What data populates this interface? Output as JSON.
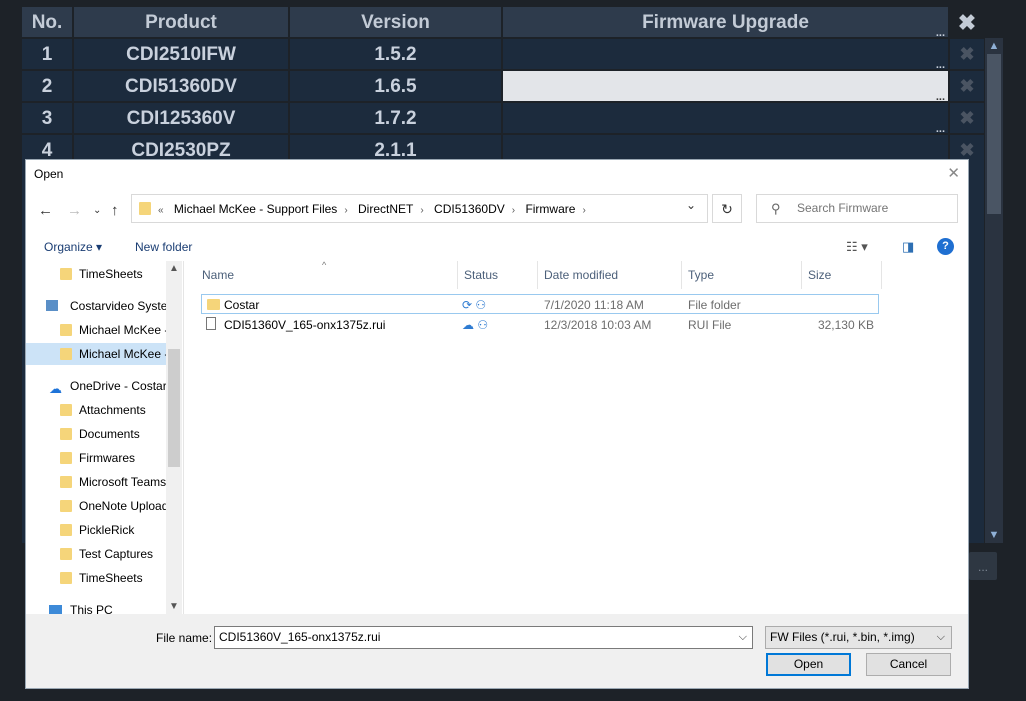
{
  "table": {
    "headers": {
      "no": "No.",
      "product": "Product",
      "version": "Version",
      "firmware": "Firmware Upgrade",
      "close": "✖"
    },
    "rows": [
      {
        "no": "1",
        "product": "CDI2510IFW",
        "version": "1.5.2"
      },
      {
        "no": "2",
        "product": "CDI51360DV",
        "version": "1.6.5"
      },
      {
        "no": "3",
        "product": "CDI125360V",
        "version": "1.7.2"
      },
      {
        "no": "4",
        "product": "CDI2530PZ",
        "version": "2.1.1"
      }
    ],
    "browse": "...",
    "delete": "✖"
  },
  "dialog": {
    "title": "Open",
    "close": "✕",
    "address": {
      "overflow": "«",
      "crumbs": [
        "Michael McKee - Support Files",
        "DirectNET",
        "CDI51360DV",
        "Firmware"
      ],
      "separator": "›"
    },
    "search_placeholder": "Search Firmware",
    "toolbar": {
      "organize": "Organize ▾",
      "new_folder": "New folder"
    },
    "nav": [
      {
        "label": "TimeSheets",
        "kind": "folder"
      },
      {
        "label": "Costarvideo Syste",
        "kind": "network"
      },
      {
        "label": "Michael McKee -",
        "kind": "folder"
      },
      {
        "label": "Michael McKee -",
        "kind": "folder",
        "selected": true
      },
      {
        "label": "OneDrive - Costar",
        "kind": "cloud"
      },
      {
        "label": "Attachments",
        "kind": "folder"
      },
      {
        "label": "Documents",
        "kind": "folder"
      },
      {
        "label": "Firmwares",
        "kind": "folder"
      },
      {
        "label": "Microsoft Teams",
        "kind": "folder"
      },
      {
        "label": "OneNote Upload",
        "kind": "folder"
      },
      {
        "label": "PickleRick",
        "kind": "folder"
      },
      {
        "label": "Test Captures",
        "kind": "folder"
      },
      {
        "label": "TimeSheets",
        "kind": "folder"
      },
      {
        "label": "This PC",
        "kind": "pc"
      }
    ],
    "columns": {
      "name": "Name",
      "status": "Status",
      "date": "Date modified",
      "type": "Type",
      "size": "Size"
    },
    "files": [
      {
        "name": "Costar",
        "status": "⟳ ⚇",
        "date": "7/1/2020 11:18 AM",
        "type": "File folder",
        "size": "",
        "kind": "folder"
      },
      {
        "name": "CDI51360V_165-onx1375z.rui",
        "status": "☁ ⚇",
        "date": "12/3/2018 10:03 AM",
        "type": "RUI File",
        "size": "32,130 KB",
        "kind": "file"
      }
    ],
    "file_name_label": "File name:",
    "file_name_value": "CDI51360V_165-onx1375z.rui",
    "file_type": "FW Files (*.rui, *.bin, *.img)",
    "open_button": "Open",
    "cancel_button": "Cancel"
  }
}
